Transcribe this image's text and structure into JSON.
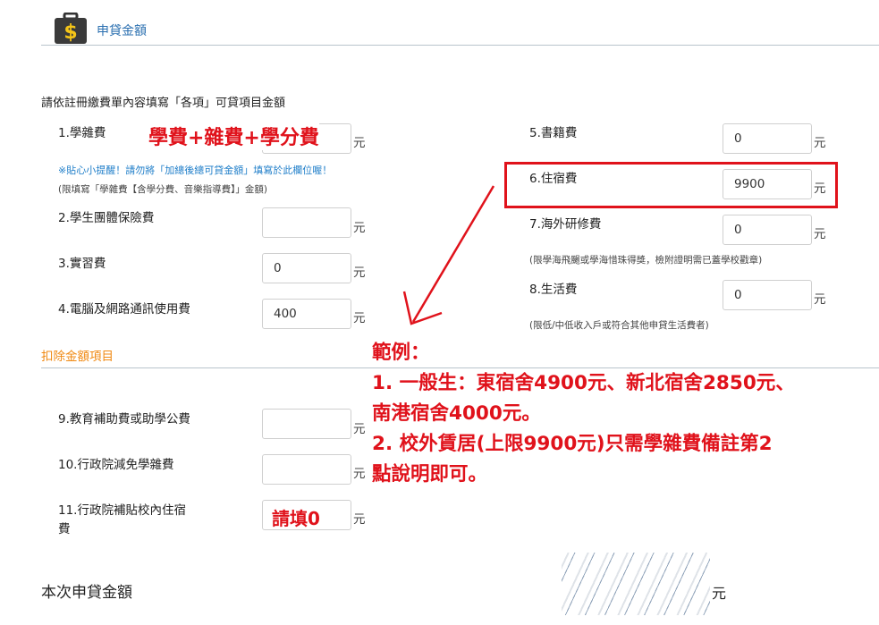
{
  "header": {
    "title": "申貸金額",
    "icon": "money-briefcase-icon",
    "icon_glyph": "$"
  },
  "instruction": "請依註冊繳費單內容填寫「各項」可貸項目金額",
  "unit": "元",
  "items": [
    {
      "label": "1.學雜費",
      "value": ""
    },
    {
      "label": "2.學生團體保險費",
      "value": ""
    },
    {
      "label": "3.實習費",
      "value": "0"
    },
    {
      "label": "4.電腦及網路通訊使用費",
      "value": "400"
    },
    {
      "label": "5.書籍費",
      "value": "0"
    },
    {
      "label": "6.住宿費",
      "value": "9900"
    },
    {
      "label": "7.海外研修費",
      "value": "0"
    },
    {
      "label": "8.生活費",
      "value": "0"
    }
  ],
  "notes": {
    "tip": "※貼心小提醒！請勿將「加總後總可貸金額」填寫於此欄位喔！",
    "tuition_limit": "(限填寫「學雜費【含學分費、音樂指導費】」金額)",
    "overseas": "(限學海飛颺或學海惜珠得獎，檢附證明需已蓋學校戳章)",
    "living": "(限低/中低收入戶或符合其他申貸生活費者)"
  },
  "deductions": {
    "title": "扣除金額項目",
    "items": [
      {
        "label": "9.教育補助費或助學公費",
        "value": ""
      },
      {
        "label": "10.行政院減免學雜費",
        "value": ""
      },
      {
        "label": "11.行政院補貼校內住宿",
        "label_line2": "費",
        "value": ""
      }
    ]
  },
  "annotations": {
    "tuition_overlay": "學費+雜費+學分費",
    "fill_zero": "請填0",
    "example_title": "範例：",
    "example_line1": "1. 一般生：東宿舍4900元、新北宿舍2850元、",
    "example_line2": "南港宿舍4000元。",
    "example_line3": "2. 校外賃居(上限9900元)只需學雜費備註第2",
    "example_line4": "點說明即可。",
    "color": "#e0121b"
  },
  "total": {
    "label": "本次申貸金額",
    "unit": "元"
  }
}
